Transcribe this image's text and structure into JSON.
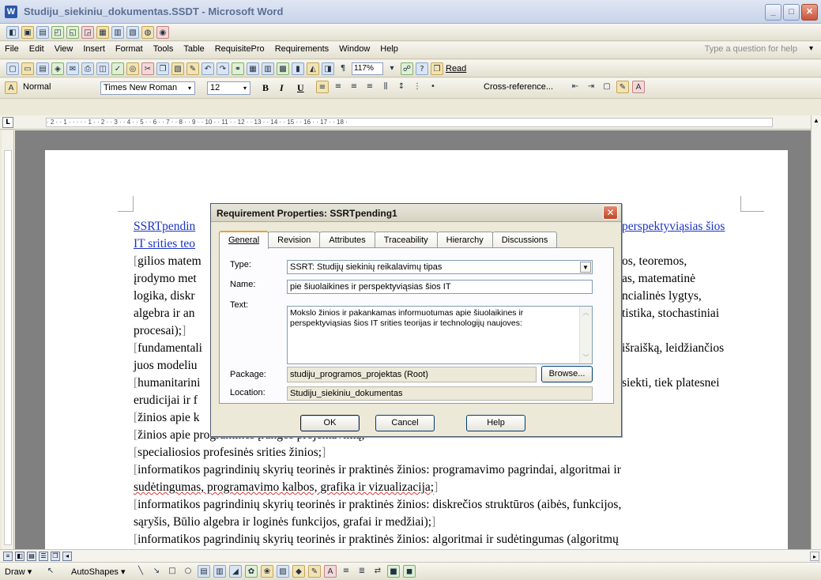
{
  "window": {
    "title": "Studiju_siekiniu_dokumentas.SSDT - Microsoft Word",
    "icon": "W",
    "buttons": [
      "_",
      "□",
      "✕"
    ]
  },
  "menu": {
    "items": [
      "File",
      "Edit",
      "View",
      "Insert",
      "Format",
      "Tools",
      "Table",
      "RequisitePro",
      "Requirements",
      "Window",
      "Help"
    ],
    "help_placeholder": "Type a question for help"
  },
  "standard_toolbar": {
    "zoom": "117%",
    "read_label": "Read"
  },
  "format_toolbar": {
    "style": "Normal",
    "font": "Times New Roman",
    "size": "12",
    "bold": "B",
    "italic": "I",
    "underline": "U",
    "cross_reference": "Cross-reference..."
  },
  "ruler": {
    "marks": "· 2 · · 1 · · · · · 1 · · 2 · · 3 · · 4 · · 5 · · 6 · · 7 · · 8 · · 9 · · 10 · · 11 · · 12 · · 13 · · 14 · · 15 · · 16 · · 17 · · 18 ·"
  },
  "document": {
    "req_line1a": "SSRTpendin",
    "req_line1b": "perspektyviąsias šios",
    "req_line2": "IT srities teo",
    "lines": [
      {
        "left": "gilios matem",
        "right": "os, teoremos,"
      },
      {
        "left": "įrodymo met",
        "right": "as, matematinė"
      },
      {
        "left": "logika, diskr",
        "right": "ncialinės lygtys,"
      },
      {
        "left": "algebra ir an",
        "right": "tistika, stochastiniai"
      },
      {
        "left": "procesai);",
        "right": ""
      },
      {
        "left": "fundamentali",
        "right": "išraišką, leidžiančios"
      },
      {
        "left": "juos modeliu",
        "right": ""
      },
      {
        "left": "humanitarini",
        "right": "siekti, tiek platesnei"
      },
      {
        "left": "erudicijai ir f",
        "right": ""
      },
      {
        "left": "žinios apie k",
        "right": ""
      }
    ],
    "full_lines": [
      "žinios apie programinės įrangos projektavimą;",
      "specialiosios profesinės srities žinios;",
      "informatikos pagrindinių skyrių teorinės ir praktinės žinios: programavimo pagrindai, algoritmai ir",
      "sudėtingumas, programavimo kalbos, grafika ir vizualizacija;",
      "informatikos pagrindinių skyrių teorinės ir praktinės žinios: diskrečios struktūros (aibės, funkcijos,",
      "sąryšis, Būlio algebra ir loginės funkcijos, grafai ir medžiai);",
      "informatikos pagrindinių skyrių teorinės ir praktinės žinios: algoritmai ir sudėtingumas (algoritmų"
    ]
  },
  "dialog": {
    "title": "Requirement Properties: SSRTpending1",
    "tabs": [
      "General",
      "Revision",
      "Attributes",
      "Traceability",
      "Hierarchy",
      "Discussions"
    ],
    "type_label": "Type:",
    "type_value": "SSRT: Studijų siekinių reikalavimų tipas",
    "name_label": "Name:",
    "name_value": "pie šiuolaikines ir perspektyviąsias šios IT",
    "text_label": "Text:",
    "text_value": "Mokslo žinios ir pakankamas informuotumas apie šiuolaikines ir perspektyviąsias šios IT srities teorijas ir technologijų naujoves:",
    "package_label": "Package:",
    "package_value": "studiju_programos_projektas (Root)",
    "browse_label": "Browse...",
    "location_label": "Location:",
    "location_value": "Studiju_siekiniu_dokumentas",
    "ok_label": "OK",
    "cancel_label": "Cancel",
    "help_label": "Help"
  },
  "drawbar": {
    "draw": "Draw ▾",
    "autoshapes": "AutoShapes ▾"
  }
}
